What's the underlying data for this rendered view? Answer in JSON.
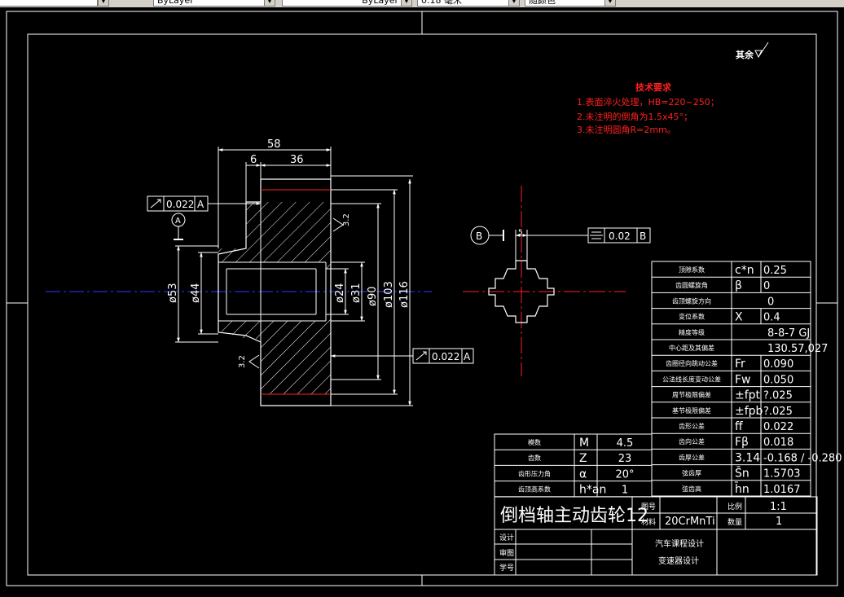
{
  "toolbar": {
    "layer": "ByLayer",
    "linetype": "ByLayer",
    "lineweight": "0.18 毫米",
    "plotstyle": "随颜色"
  },
  "drawing": {
    "surface_roughness_rest": "其余",
    "tech_req": {
      "title": "技术要求",
      "lines": [
        "1.表面淬火处理，HB=220~250；",
        "2.未注明的倒角为1.5x45°；",
        "3.未注明圆角R=2mm。"
      ]
    },
    "dims": {
      "d58": "58",
      "d6": "6",
      "d36": "36",
      "dia53": "ø53",
      "dia44": "ø44",
      "dia24": "ø24",
      "dia31": "ø31",
      "dia90": "ø90",
      "dia103": "ø103",
      "dia116": "ø116",
      "key_w": "5"
    },
    "roughness": "3.2",
    "datum_a": "A",
    "datum_b": "B",
    "runout_top": {
      "value": "0.022",
      "datum": "A"
    },
    "runout_bottom": {
      "value": "0.022",
      "datum": "A"
    },
    "symmetry": {
      "value": "0.02",
      "datum": "B"
    }
  },
  "param_table": {
    "rows": [
      {
        "label": "顶隙系数",
        "symbol": "c*n",
        "value": "0.25"
      },
      {
        "label": "齿圆螺旋角",
        "symbol": "β",
        "value": "0"
      },
      {
        "label": "齿顶螺旋方向",
        "symbol": "",
        "value": "0"
      },
      {
        "label": "变位系数",
        "symbol": "X",
        "value": "0.4"
      },
      {
        "label": "精度等级",
        "symbol": "",
        "value": "8-8-7 GJ"
      },
      {
        "label": "中心距及其偏差",
        "symbol": "",
        "value": "130.57,027"
      },
      {
        "label": "齿圈径向跳动公差",
        "symbol": "Fr",
        "value": "0.090"
      },
      {
        "label": "公法线长度变动公差",
        "symbol": "Fw",
        "value": "0.050"
      },
      {
        "label": "周节极限偏差",
        "symbol": "±fpt",
        "value": "?.025"
      },
      {
        "label": "基节极限偏差",
        "symbol": "±fpb",
        "value": "?.025"
      },
      {
        "label": "齿形公差",
        "symbol": "ff",
        "value": "0.022"
      },
      {
        "label": "齿向公差",
        "symbol": "Fβ",
        "value": "0.018"
      },
      {
        "label": "齿厚公差",
        "symbol": "3.14",
        "value": "-0.168 / -0.280"
      },
      {
        "label": "弦齿厚",
        "symbol": "S̄n",
        "value": "1.5703"
      },
      {
        "label": "弦齿高",
        "symbol": "h̄n",
        "value": "1.0167"
      }
    ]
  },
  "basic_table": {
    "rows": [
      {
        "label": "模数",
        "symbol": "M",
        "value": "4.5"
      },
      {
        "label": "齿数",
        "symbol": "Z",
        "value": "23"
      },
      {
        "label": "齿形压力角",
        "symbol": "α",
        "value": "20°"
      },
      {
        "label": "齿顶高系数",
        "symbol": "h*an",
        "value": "1"
      }
    ]
  },
  "title_block": {
    "part_name": "倒档轴主动齿轮12",
    "drawing_no_label": "图号",
    "material_label": "材料",
    "material": "20CrMnTi",
    "scale_label": "比例",
    "scale": "1:1",
    "qty_label": "数量",
    "qty": "1",
    "designer_label": "设计",
    "checker_label": "审图",
    "school_label": "学号",
    "course": "汽车课程设计",
    "project": "变速器设计"
  },
  "colors": {
    "line": "#ffffff",
    "red": "#ff2020",
    "blue": "#2a3cff",
    "bg": "#000000"
  }
}
